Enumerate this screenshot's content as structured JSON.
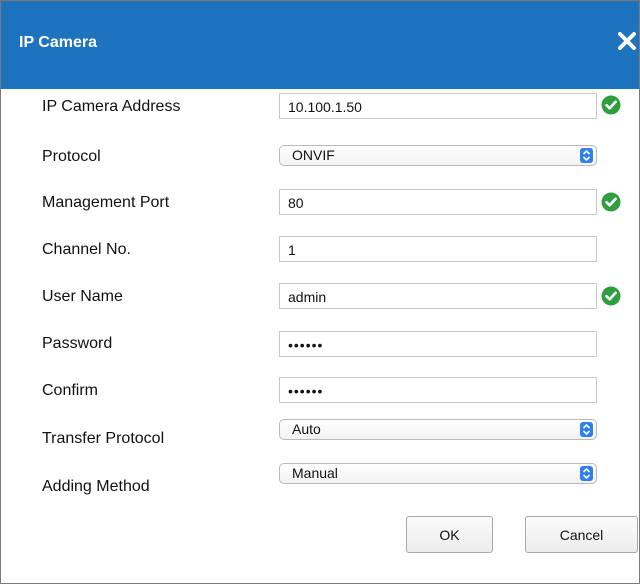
{
  "dialog": {
    "title": "IP Camera"
  },
  "form": {
    "ip_address": {
      "label": "IP Camera Address",
      "value": "10.100.1.50"
    },
    "protocol": {
      "label": "Protocol",
      "value": "ONVIF"
    },
    "management_port": {
      "label": "Management Port",
      "value": "80"
    },
    "channel_no": {
      "label": "Channel No.",
      "value": "1"
    },
    "user_name": {
      "label": "User Name",
      "value": "admin"
    },
    "password": {
      "label": "Password",
      "value": "••••••"
    },
    "confirm": {
      "label": "Confirm",
      "value": "••••••"
    },
    "transfer_protocol": {
      "label": "Transfer Protocol",
      "value": "Auto"
    },
    "adding_method": {
      "label": "Adding Method",
      "value": "Manual"
    }
  },
  "buttons": {
    "ok": "OK",
    "cancel": "Cancel"
  },
  "colors": {
    "title_bar": "#1e73bf",
    "valid_check": "#2e9e3e",
    "select_arrow": "#2f7ff0"
  }
}
